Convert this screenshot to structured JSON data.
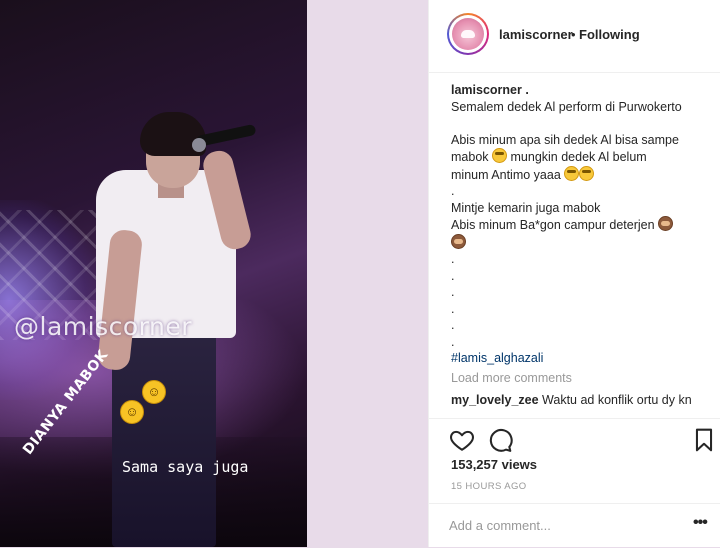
{
  "media": {
    "watermark": "@lamiscorner",
    "tilted_caption": "DIANYA MABOK",
    "bottom_caption": "Sama saya juga",
    "overlay_emojis": [
      "rofl-emoji",
      "rofl-emoji"
    ]
  },
  "header": {
    "username": "lamiscorner",
    "separator": "•",
    "follow_status": "Following"
  },
  "caption": {
    "username": "lamiscorner .",
    "lines": [
      "Semalem dedek Al perform di Purwokerto",
      "",
      "Abis minum apa sih dedek Al bisa sampe",
      "mabok",
      "mungkin dedek Al belum",
      "minum Antimo yaaa",
      ".",
      "Mintje kemarin juga mabok",
      "Abis minum Ba*gon campur deterjen",
      ".",
      ".",
      ".",
      ".",
      ".",
      ".",
      "#lamis_alghazali"
    ]
  },
  "load_more": "Load more comments",
  "comment": {
    "username": "my_lovely_zee",
    "text": "Waktu ad konflik ortu dy kn"
  },
  "actions": {
    "like": "heart-icon",
    "comment": "comment-bubble-icon",
    "save": "bookmark-icon"
  },
  "stats": {
    "views": "153,257 views",
    "time": "15 HOURS AGO"
  },
  "add_comment": {
    "placeholder": "Add a comment...",
    "more": "•••"
  },
  "colors": {
    "hashtag": "#003569",
    "muted": "#999999",
    "text": "#262626",
    "background": "#e8dbe9"
  }
}
